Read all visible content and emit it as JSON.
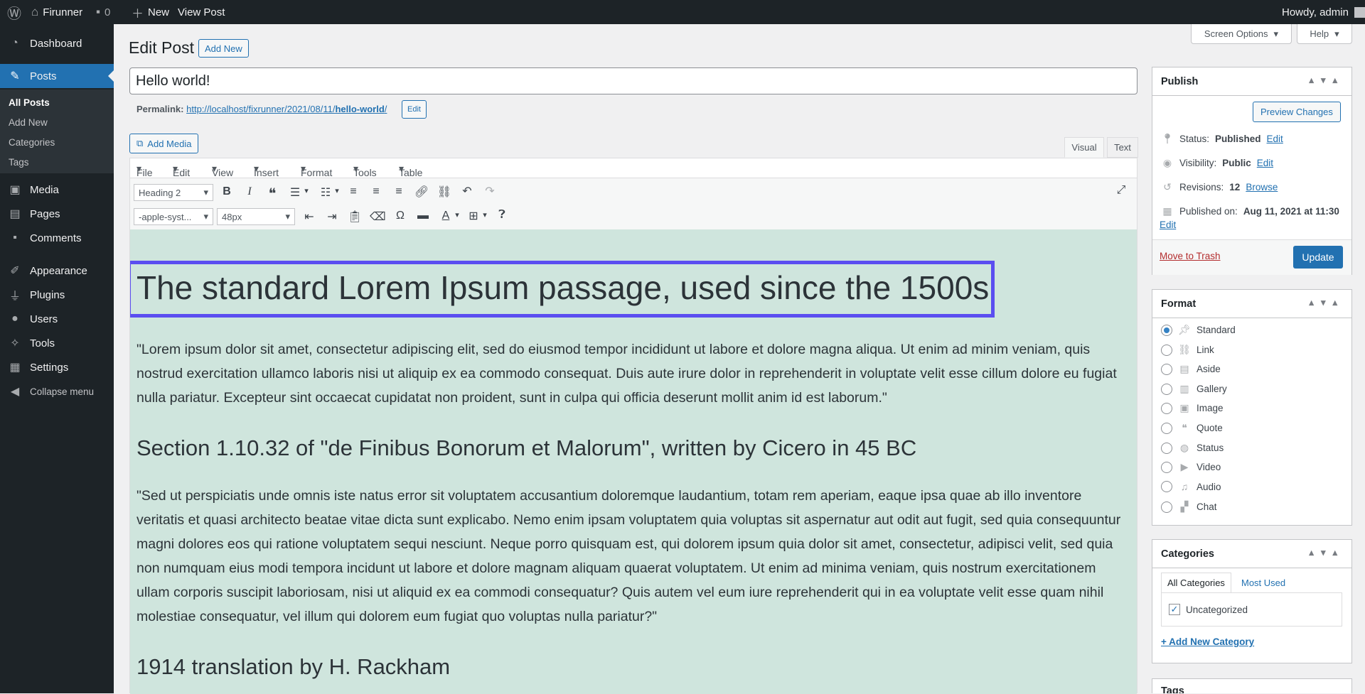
{
  "adminbar": {
    "site": "Firunner",
    "comments": "0",
    "new": "New",
    "view": "View Post",
    "howdy": "Howdy, admin"
  },
  "sidebar": {
    "dashboard": "Dashboard",
    "posts": "Posts",
    "sub": [
      "All Posts",
      "Add New",
      "Categories",
      "Tags"
    ],
    "media": "Media",
    "pages": "Pages",
    "comments": "Comments",
    "appearance": "Appearance",
    "plugins": "Plugins",
    "users": "Users",
    "tools": "Tools",
    "settings": "Settings",
    "collapse": "Collapse menu"
  },
  "screen_options": "Screen Options",
  "help": "Help",
  "page_title": "Edit Post",
  "add_new": "Add New",
  "post_title": "Hello world!",
  "permalink": {
    "label": "Permalink:",
    "url_prefix": "http://localhost/fixrunner/2021/08/11/",
    "slug": "hello-world",
    "suffix": "/",
    "edit": "Edit"
  },
  "add_media": "Add Media",
  "tabs": {
    "visual": "Visual",
    "text": "Text"
  },
  "menus": [
    "File",
    "Edit",
    "View",
    "Insert",
    "Format",
    "Tools",
    "Table"
  ],
  "toolbar": {
    "block": "Heading 2",
    "font": "-apple-syst...",
    "size": "48px"
  },
  "content": {
    "h2a": "The standard Lorem Ipsum passage, used since the 1500s",
    "p1": "\"Lorem ipsum dolor sit amet, consectetur adipiscing elit, sed do eiusmod tempor incididunt ut labore et dolore magna aliqua. Ut enim ad minim veniam, quis nostrud exercitation ullamco laboris nisi ut aliquip ex ea commodo consequat. Duis aute irure dolor in reprehenderit in voluptate velit esse cillum dolore eu fugiat nulla pariatur. Excepteur sint occaecat cupidatat non proident, sunt in culpa qui officia deserunt mollit anim id est laborum.\"",
    "h2b": "Section 1.10.32 of \"de Finibus Bonorum et Malorum\", written by Cicero in 45 BC",
    "p2": "\"Sed ut perspiciatis unde omnis iste natus error sit voluptatem accusantium doloremque laudantium, totam rem aperiam, eaque ipsa quae ab illo inventore veritatis et quasi architecto beatae vitae dicta sunt explicabo. Nemo enim ipsam voluptatem quia voluptas sit aspernatur aut odit aut fugit, sed quia consequuntur magni dolores eos qui ratione voluptatem sequi nesciunt. Neque porro quisquam est, qui dolorem ipsum quia dolor sit amet, consectetur, adipisci velit, sed quia non numquam eius modi tempora incidunt ut labore et dolore magnam aliquam quaerat voluptatem. Ut enim ad minima veniam, quis nostrum exercitationem ullam corporis suscipit laboriosam, nisi ut aliquid ex ea commodi consequatur? Quis autem vel eum iure reprehenderit qui in ea voluptate velit esse quam nihil molestiae consequatur, vel illum qui dolorem eum fugiat quo voluptas nulla pariatur?\"",
    "h2c": "1914 translation by H. Rackham"
  },
  "publish": {
    "title": "Publish",
    "preview": "Preview Changes",
    "status_label": "Status:",
    "status": "Published",
    "visibility_label": "Visibility:",
    "visibility": "Public",
    "revisions_label": "Revisions:",
    "revisions": "12",
    "browse": "Browse",
    "published_label": "Published on:",
    "published": "Aug 11, 2021 at 11:30",
    "edit": "Edit",
    "trash": "Move to Trash",
    "update": "Update"
  },
  "format": {
    "title": "Format",
    "options": [
      "Standard",
      "Link",
      "Aside",
      "Gallery",
      "Image",
      "Quote",
      "Status",
      "Video",
      "Audio",
      "Chat"
    ],
    "selected": "Standard"
  },
  "categories": {
    "title": "Categories",
    "tab_all": "All Categories",
    "tab_used": "Most Used",
    "items": [
      "Uncategorized"
    ],
    "add": "+ Add New Category"
  },
  "tags": {
    "title": "Tags"
  },
  "colors": {
    "accent": "#2271b1",
    "highlight": "#5b4ef0",
    "editor_bg": "#cfe5dd",
    "adminbar": "#1d2327"
  }
}
